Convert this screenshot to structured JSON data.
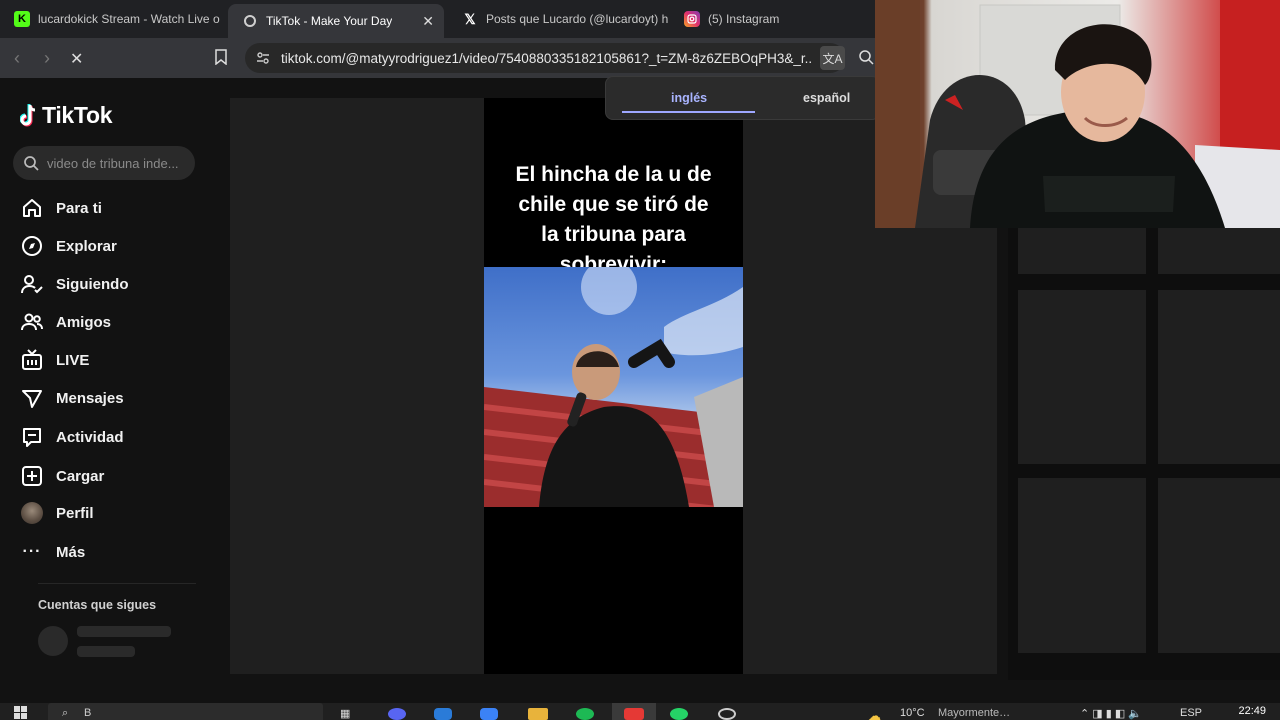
{
  "browser": {
    "tabs": [
      {
        "title": "lucardokick Stream - Watch Live o",
        "favicon": "kick-icon",
        "color": "#53fc18",
        "active": false
      },
      {
        "title": "TikTok - Make Your Day",
        "favicon": "tiktok-icon",
        "color": "#cccccc",
        "active": true
      },
      {
        "title": "Posts que Lucardo (@lucardoyt) h",
        "favicon": "x-icon",
        "color": "#ffffff",
        "active": false
      },
      {
        "title": "(5) Instagram",
        "favicon": "instagram-icon",
        "color": "#e1306c",
        "active": false
      }
    ],
    "url": "tiktok.com/@matyyrodriguez1/video/7540880335182105861?_t=ZM-8z6ZEBOqPH3&_r...",
    "translate": {
      "lang1": "inglés",
      "lang2": "español"
    }
  },
  "sidebar": {
    "logo": "TikTok",
    "search_placeholder": "video de tribuna inde...",
    "items": [
      {
        "label": "Para ti",
        "icon": "home-icon"
      },
      {
        "label": "Explorar",
        "icon": "compass-icon"
      },
      {
        "label": "Siguiendo",
        "icon": "user-follow-icon"
      },
      {
        "label": "Amigos",
        "icon": "friends-icon"
      },
      {
        "label": "LIVE",
        "icon": "live-icon"
      },
      {
        "label": "Mensajes",
        "icon": "send-icon"
      },
      {
        "label": "Actividad",
        "icon": "inbox-icon"
      },
      {
        "label": "Cargar",
        "icon": "upload-icon"
      },
      {
        "label": "Perfil",
        "icon": "avatar-icon"
      },
      {
        "label": "Más",
        "icon": "more-icon"
      }
    ],
    "following_title": "Cuentas que sigues"
  },
  "video": {
    "caption_lines": [
      "El hincha de la u de",
      "chile que  se tiró de",
      "la tribuna para",
      "sobrevivir:"
    ]
  },
  "taskbar": {
    "search": "B",
    "weather": "10°C",
    "weather_text": "Mayormente…",
    "lang": "ESP",
    "time": "22:49"
  }
}
